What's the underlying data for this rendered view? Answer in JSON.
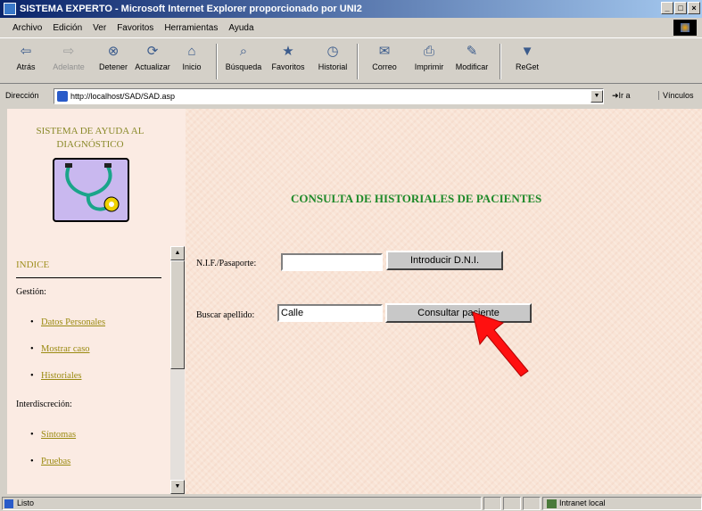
{
  "window": {
    "title": "SISTEMA EXPERTO - Microsoft Internet Explorer proporcionado por UNI2"
  },
  "menu": [
    "Archivo",
    "Edición",
    "Ver",
    "Favoritos",
    "Herramientas",
    "Ayuda"
  ],
  "toolbar": [
    {
      "label": "Atrás",
      "icon": "back-arrow-icon",
      "glyph": "⇦",
      "enabled": true
    },
    {
      "label": "Adelante",
      "icon": "forward-arrow-icon",
      "glyph": "⇨",
      "enabled": false
    },
    {
      "label": "Detener",
      "icon": "stop-icon",
      "glyph": "⊗",
      "enabled": true
    },
    {
      "label": "Actualizar",
      "icon": "refresh-icon",
      "glyph": "⟳",
      "enabled": true
    },
    {
      "label": "Inicio",
      "icon": "home-icon",
      "glyph": "⌂",
      "enabled": true
    },
    {
      "label": "Búsqueda",
      "icon": "search-icon",
      "glyph": "⌕",
      "enabled": true
    },
    {
      "label": "Favoritos",
      "icon": "favorites-icon",
      "glyph": "★",
      "enabled": true
    },
    {
      "label": "Historial",
      "icon": "history-icon",
      "glyph": "◷",
      "enabled": true
    },
    {
      "label": "Correo",
      "icon": "mail-icon",
      "glyph": "✉",
      "enabled": true
    },
    {
      "label": "Imprimir",
      "icon": "print-icon",
      "glyph": "⎙",
      "enabled": true
    },
    {
      "label": "Modificar",
      "icon": "edit-icon",
      "glyph": "✎",
      "enabled": true
    },
    {
      "label": "ReGet",
      "icon": "reget-icon",
      "glyph": "▼",
      "enabled": true
    }
  ],
  "address": {
    "label": "Dirección",
    "url": "http://localhost/SAD/SAD.asp",
    "go": "Ir a",
    "links": "Vínculos"
  },
  "sidebar": {
    "title": "SISTEMA DE AYUDA AL DIAGNÓSTICO",
    "index": "INDICE",
    "sections": [
      {
        "label": "Gestión:",
        "items": [
          "Datos Personales",
          "Mostrar caso",
          "Historiales"
        ]
      },
      {
        "label": "Interdiscreción:",
        "items": [
          "Síntomas",
          "Pruebas"
        ]
      }
    ]
  },
  "main": {
    "heading": "CONSULTA DE HISTORIALES DE PACIENTES",
    "nif_label": "N.I.F./Pasaporte:",
    "nif_value": "",
    "dni_button": "Introducir D.N.I.",
    "surname_label": "Buscar apellido:",
    "surname_value": "Calle",
    "consult_button": "Consultar paciente"
  },
  "status": {
    "text": "Listo",
    "zone": "Intranet local"
  }
}
